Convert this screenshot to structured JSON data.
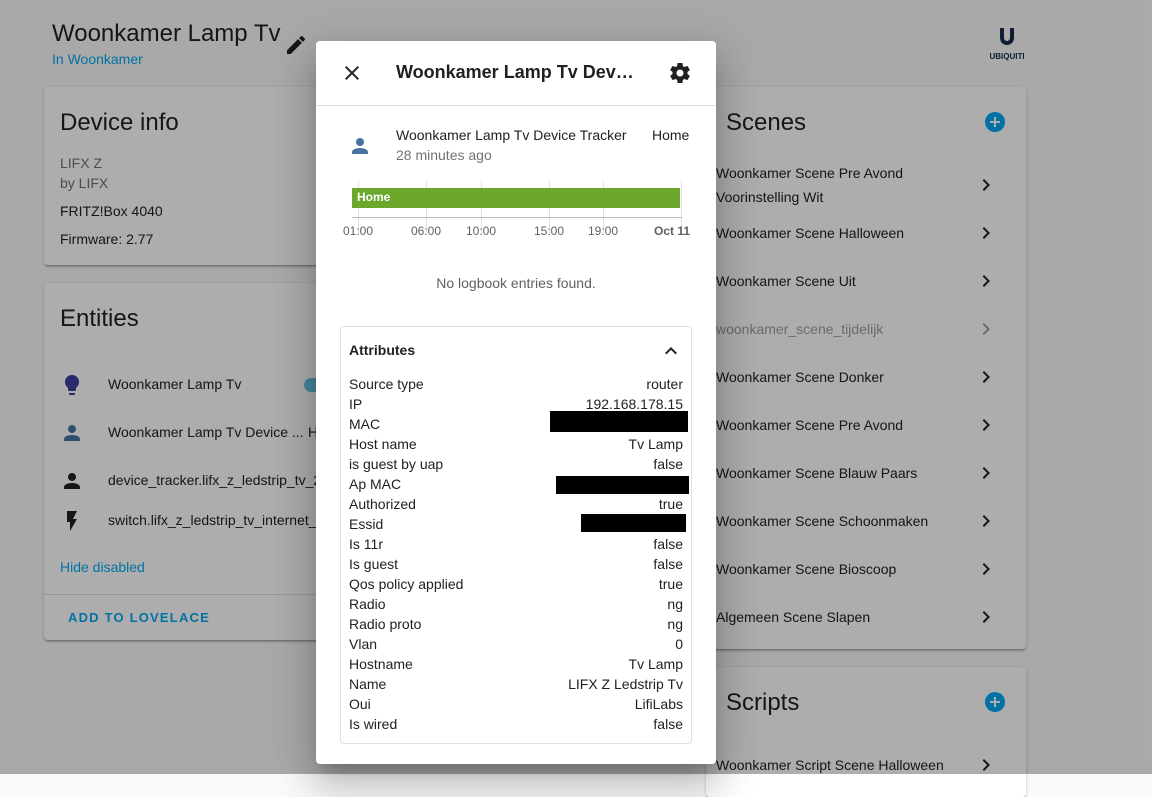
{
  "device": {
    "title": "Woonkamer Lamp Tv",
    "area": "In Woonkamer",
    "logo_text": "UBIQUITI"
  },
  "device_info": {
    "title": "Device info",
    "model": "LIFX Z",
    "manufacturer": "by LIFX",
    "via": "FRITZ!Box 4040",
    "firmware": "Firmware: 2.77"
  },
  "entities": {
    "title": "Entities",
    "items": [
      {
        "label": "Woonkamer Lamp Tv",
        "icon": "lightbulb-icon"
      },
      {
        "label": "Woonkamer Lamp Tv Device ...",
        "icon": "account-icon",
        "state": "H"
      },
      {
        "label": "device_tracker.lifx_z_ledstrip_tv_2",
        "icon": "account-icon"
      },
      {
        "label": "switch.lifx_z_ledstrip_tv_internet_",
        "icon": "flash-icon"
      }
    ],
    "hide_disabled": "Hide disabled",
    "add_to_lovelace": "ADD TO LOVELACE"
  },
  "scenes": {
    "title": "Scenes",
    "items": [
      {
        "label": "Woonkamer Scene Pre Avond Voorinstelling Wit",
        "disabled": false
      },
      {
        "label": "Woonkamer Scene Halloween",
        "disabled": false
      },
      {
        "label": "Woonkamer Scene Uit",
        "disabled": false
      },
      {
        "label": "woonkamer_scene_tijdelijk",
        "disabled": true
      },
      {
        "label": "Woonkamer Scene Donker",
        "disabled": false
      },
      {
        "label": "Woonkamer Scene Pre Avond",
        "disabled": false
      },
      {
        "label": "Woonkamer Scene Blauw Paars",
        "disabled": false
      },
      {
        "label": "Woonkamer Scene Schoonmaken",
        "disabled": false
      },
      {
        "label": "Woonkamer Scene Bioscoop",
        "disabled": false
      },
      {
        "label": "Algemeen Scene Slapen",
        "disabled": false
      }
    ]
  },
  "scripts": {
    "title": "Scripts",
    "items": [
      {
        "label": "Woonkamer Script Scene Halloween"
      }
    ]
  },
  "dialog": {
    "title": "Woonkamer Lamp Tv Device...",
    "entity_name": "Woonkamer Lamp Tv Device Tracker",
    "state": "Home",
    "last_changed": "28 minutes ago",
    "timeline": {
      "bar_label": "Home",
      "bar_color": "#6aa72a",
      "ticks": [
        "01:00",
        "06:00",
        "10:00",
        "15:00",
        "19:00",
        "Oct 11"
      ]
    },
    "logbook_empty": "No logbook entries found.",
    "attributes_title": "Attributes",
    "attributes": [
      {
        "key": "Source type",
        "value": "router"
      },
      {
        "key": "IP",
        "value": "192.168.178.15"
      },
      {
        "key": "MAC",
        "value": ""
      },
      {
        "key": "Host name",
        "value": "Tv Lamp"
      },
      {
        "key": "is guest by uap",
        "value": "false"
      },
      {
        "key": "Ap MAC",
        "value": ""
      },
      {
        "key": "Authorized",
        "value": "true"
      },
      {
        "key": "Essid",
        "value": ""
      },
      {
        "key": "Is 11r",
        "value": "false"
      },
      {
        "key": "Is guest",
        "value": "false"
      },
      {
        "key": "Qos policy applied",
        "value": "true"
      },
      {
        "key": "Radio",
        "value": "ng"
      },
      {
        "key": "Radio proto",
        "value": "ng"
      },
      {
        "key": "Vlan",
        "value": "0"
      },
      {
        "key": "Hostname",
        "value": "Tv Lamp"
      },
      {
        "key": "Name",
        "value": "LIFX Z Ledstrip Tv"
      },
      {
        "key": "Oui",
        "value": "LifiLabs"
      },
      {
        "key": "Is wired",
        "value": "false"
      }
    ]
  },
  "colors": {
    "accent": "#03a9f4",
    "icon_blue": "#44739e",
    "lamp_icon": "#3f3d9e"
  }
}
